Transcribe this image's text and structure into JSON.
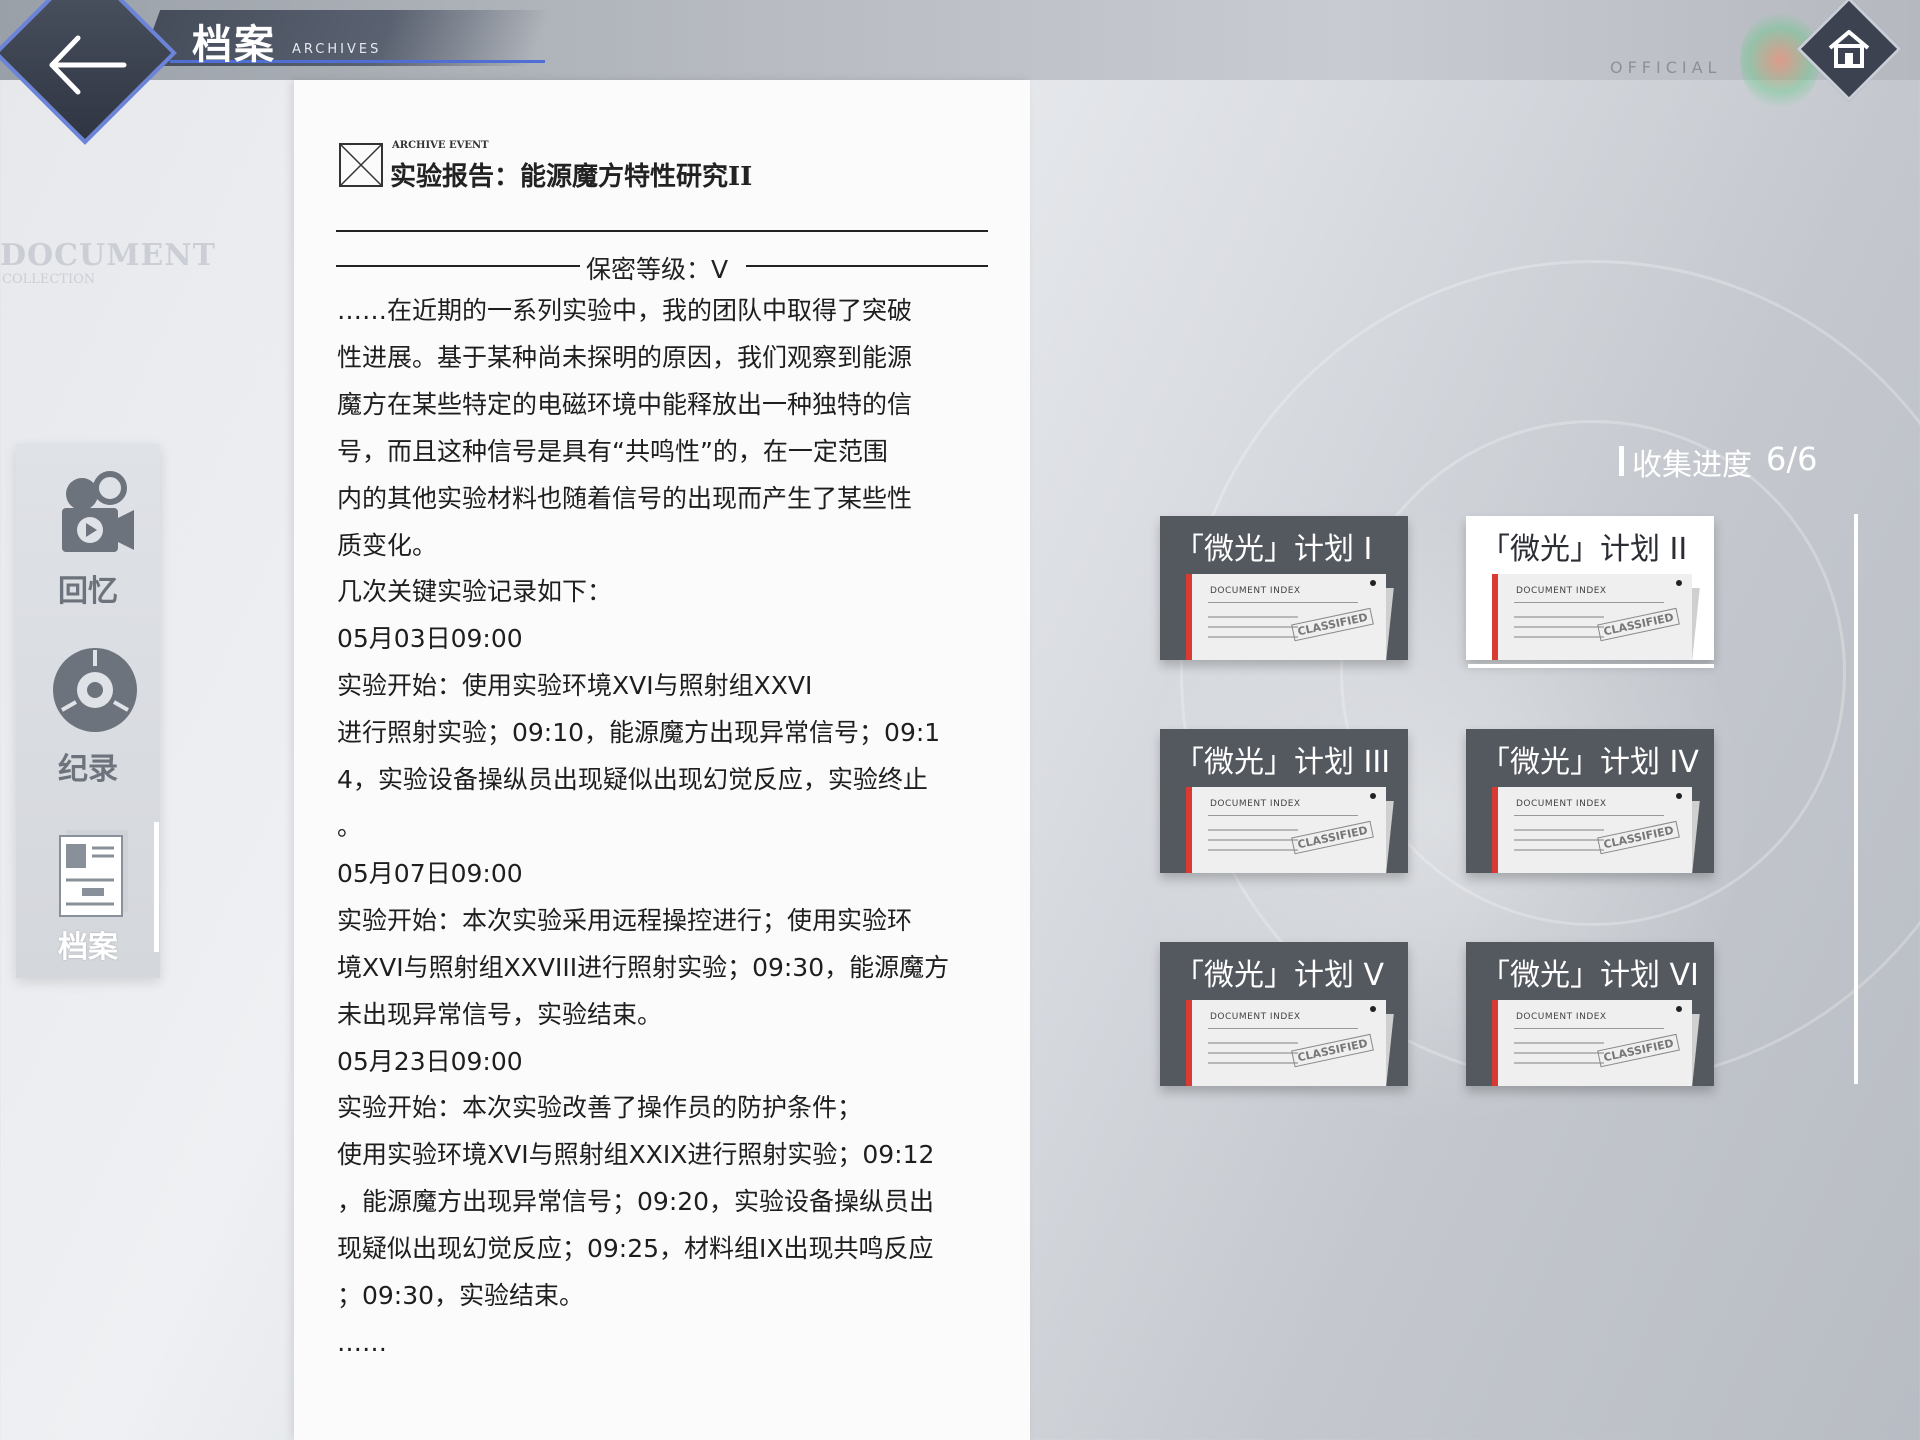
{
  "header": {
    "title": "档案",
    "subtitle": "ARCHIVES",
    "back_icon": "back-arrow-icon",
    "home_icon": "home-icon",
    "official_text": "OFFICIAL"
  },
  "background": {
    "watermark_title": "DOCUMENT",
    "watermark_sub": "COLLECTION"
  },
  "sidebar": {
    "items": [
      {
        "label": "回忆",
        "icon": "camera-icon",
        "active": false
      },
      {
        "label": "纪录",
        "icon": "record-disc-icon",
        "active": false
      },
      {
        "label": "档案",
        "icon": "archive-document-icon",
        "active": true
      }
    ]
  },
  "document": {
    "icon": "image-placeholder-icon",
    "category": "ARCHIVE EVENT",
    "title": "实验报告：能源魔方特性研究II",
    "secrecy": "保密等级：V",
    "lines": [
      "……在近期的一系列实验中，我的团队中取得了突破",
      "性进展。基于某种尚未探明的原因，我们观察到能源",
      "魔方在某些特定的电磁环境中能释放出一种独特的信",
      "号，而且这种信号是具有“共鸣性”的，在一定范围",
      "内的其他实验材料也随着信号的出现而产生了某些性",
      "质变化。",
      "几次关键实验记录如下：",
      "05月03日09:00",
      "实验开始：使用实验环境XVI与照射组XXVI",
      "进行照射实验；09:10，能源魔方出现异常信号；09:1",
      "4，实验设备操纵员出现疑似出现幻觉反应，实验终止",
      "。",
      "05月07日09:00",
      "实验开始：本次实验采用远程操控进行；使用实验环",
      "境XVI与照射组XXVIII进行照射实验；09:30，能源魔方",
      "未出现异常信号，实验结束。",
      "05月23日09:00",
      "实验开始：本次实验改善了操作员的防护条件；",
      "使用实验环境XVI与照射组XXIX进行照射实验；09:12",
      "，能源魔方出现异常信号；09:20，实验设备操纵员出",
      "现疑似出现幻觉反应；09:25，材料组IX出现共鸣反应",
      "；09:30，实验结束。",
      "……"
    ]
  },
  "collection": {
    "label": "收集进度",
    "progress": "6/6",
    "cards": [
      {
        "title": "「微光」计划 I",
        "selected": false,
        "paper_head": "DOCUMENT INDEX",
        "stamp": "CLASSIFIED"
      },
      {
        "title": "「微光」计划 II",
        "selected": true,
        "paper_head": "DOCUMENT INDEX",
        "stamp": "CLASSIFIED"
      },
      {
        "title": "「微光」计划 III",
        "selected": false,
        "paper_head": "DOCUMENT INDEX",
        "stamp": "CLASSIFIED"
      },
      {
        "title": "「微光」计划 IV",
        "selected": false,
        "paper_head": "DOCUMENT INDEX",
        "stamp": "CLASSIFIED"
      },
      {
        "title": "「微光」计划 V",
        "selected": false,
        "paper_head": "DOCUMENT INDEX",
        "stamp": "CLASSIFIED"
      },
      {
        "title": "「微光」计划 VI",
        "selected": false,
        "paper_head": "DOCUMENT INDEX",
        "stamp": "CLASSIFIED"
      }
    ]
  }
}
